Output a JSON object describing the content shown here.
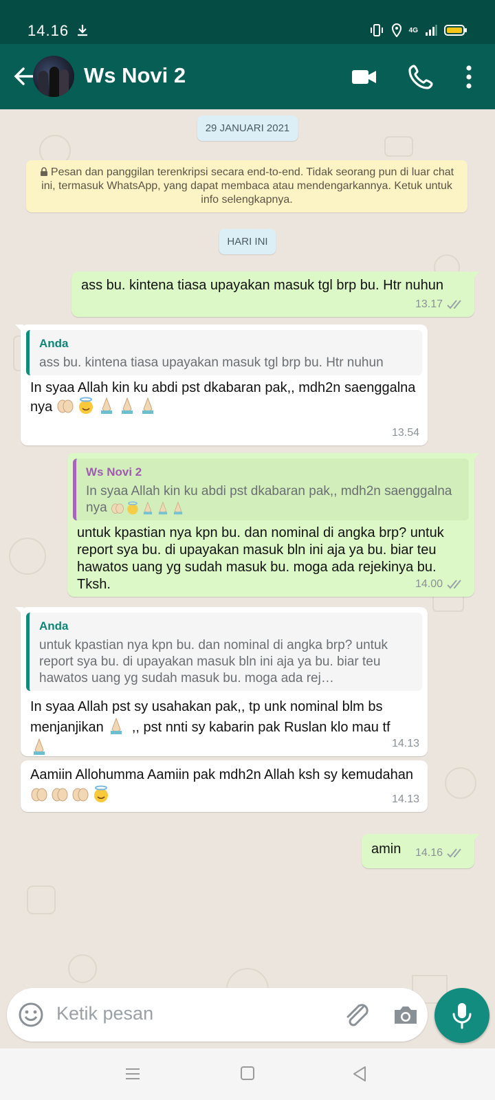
{
  "status_bar": {
    "time": "14.16",
    "network": "4G"
  },
  "header": {
    "contact_name": "Ws Novi 2"
  },
  "chat": {
    "date_pill": "29 JANUARI 2021",
    "encryption_notice": "Pesan dan panggilan terenkripsi secara end-to-end. Tidak seorang pun di luar chat ini, termasuk WhatsApp, yang dapat membaca atau mendengarkannya. Ketuk untuk info selengkapnya.",
    "today_pill": "HARI INI",
    "messages": [
      {
        "direction": "out",
        "text": "ass bu. kintena tiasa upayakan masuk tgl brp bu. Htr nuhun",
        "time": "13.17",
        "status": "read"
      },
      {
        "direction": "in",
        "quote_name": "Anda",
        "quote_text": "ass bu. kintena tiasa upayakan masuk tgl brp bu. Htr nuhun",
        "text": "In syaa Allah kin ku abdi pst dkabaran pak,, mdh2n saenggalna nya",
        "time": "13.54"
      },
      {
        "direction": "out",
        "quote_name": "Ws Novi 2",
        "quote_text": "In syaa Allah kin ku abdi pst dkabaran pak,, mdh2n saenggalna nya",
        "text": "untuk kpastian nya kpn bu. dan nominal di angka brp? untuk report sya bu. di upayakan masuk bln ini aja ya bu. biar teu hawatos uang yg sudah masuk bu. moga ada rejekinya bu. Tksh.",
        "time": "14.00",
        "status": "read"
      },
      {
        "direction": "in",
        "quote_name": "Anda",
        "quote_text": "untuk kpastian nya kpn bu. dan nominal di angka brp? untuk report sya bu. di upayakan masuk bln ini aja ya bu. biar teu hawatos uang yg sudah masuk bu. moga ada rej…",
        "text_a": "In syaa Allah pst sy usahakan pak,, tp unk nominal blm bs menjanjikan",
        "text_b": ",, pst nnti sy kabarin pak Ruslan klo mau tf",
        "time": "14.13"
      },
      {
        "direction": "in",
        "text": "Aamiin Allohumma Aamiin pak mdh2n Allah ksh sy kemudahan",
        "time": "14.13"
      },
      {
        "direction": "out",
        "text": "amin",
        "time": "14.16",
        "status": "read"
      }
    ]
  },
  "composer": {
    "placeholder": "Ketik pesan"
  },
  "icons": {
    "back": "arrow-left-icon",
    "video": "video-camera-icon",
    "call": "phone-icon",
    "menu": "more-vertical-icon",
    "emoji": "emoji-icon",
    "attach": "paperclip-icon",
    "camera": "camera-icon",
    "mic": "microphone-icon"
  },
  "colors": {
    "header": "#075e54",
    "status_bar": "#054d44",
    "outgoing": "#dcf8c6",
    "incoming": "#ffffff",
    "accent": "#128c7e"
  }
}
